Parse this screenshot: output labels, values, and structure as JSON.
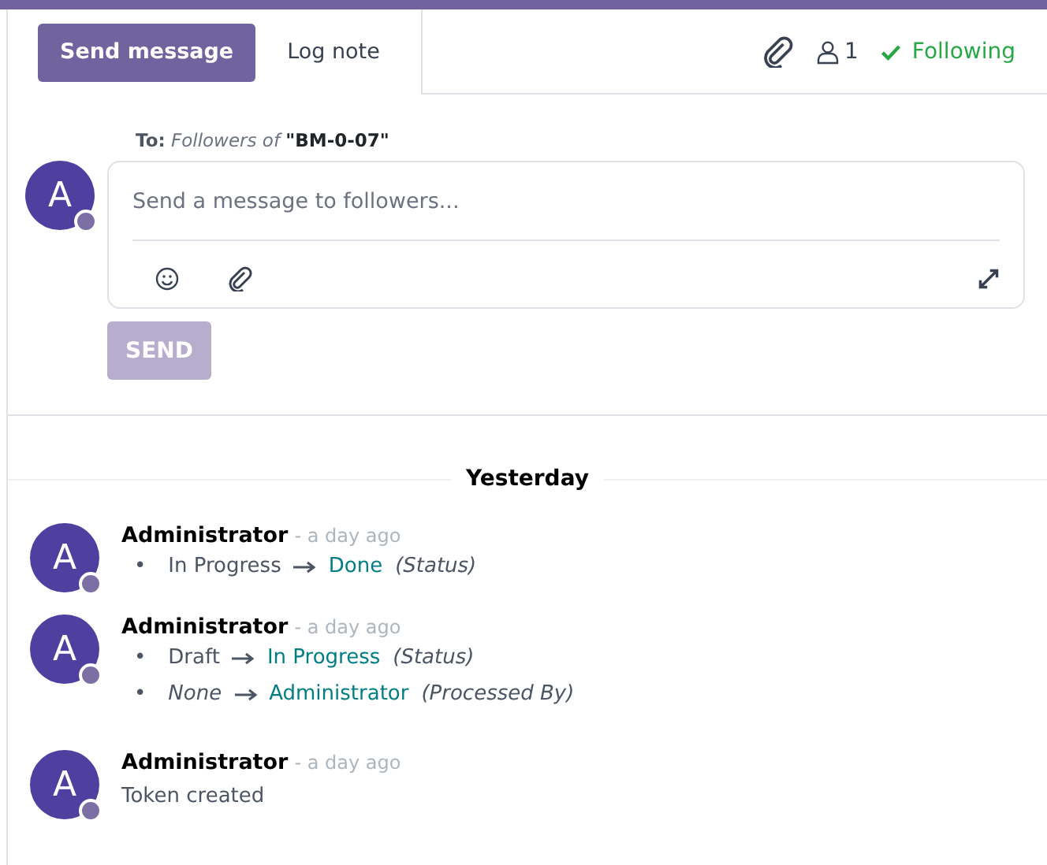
{
  "tabs": [
    {
      "label": "Send message",
      "selected": true
    },
    {
      "label": "Log note",
      "selected": false
    }
  ],
  "topbar": {
    "followers_count": "1",
    "follow_label": "Following",
    "following": true
  },
  "composer": {
    "to_label": "To:",
    "to_followers": "Followers of",
    "record": "\"BM-0-07\"",
    "avatar": "A",
    "placeholder": "Send a message to followers...",
    "send": {
      "label": "SEND",
      "disabled": true
    }
  },
  "date_separator": "Yesterday",
  "messages": [
    {
      "avatar": "A",
      "author": "Administrator",
      "time": "- a day ago",
      "kind": "tracking",
      "changes": [
        {
          "bullet": "•",
          "old": "In Progress",
          "old_empty": false,
          "new": "Done",
          "field": "(Status)"
        }
      ]
    },
    {
      "avatar": "A",
      "author": "Administrator",
      "time": "- a day ago",
      "kind": "tracking",
      "changes": [
        {
          "bullet": "•",
          "old": "Draft",
          "old_empty": false,
          "new": "In Progress",
          "field": "(Status)"
        },
        {
          "bullet": "•",
          "old": "None",
          "old_empty": true,
          "new": "Administrator",
          "field": "(Processed By)"
        }
      ]
    },
    {
      "avatar": "A",
      "author": "Administrator",
      "time": "- a day ago",
      "kind": "text",
      "body": "Token created"
    }
  ]
}
